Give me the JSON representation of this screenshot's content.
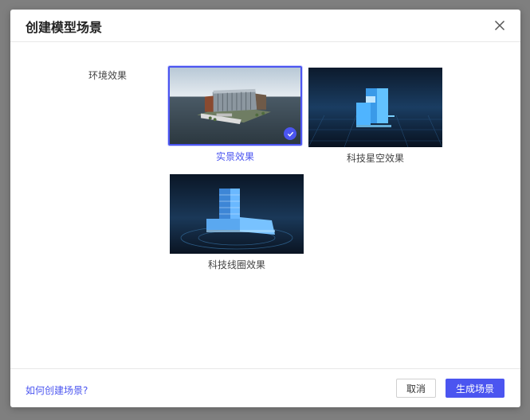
{
  "dialog": {
    "title": "创建模型场景",
    "field_label": "环境效果",
    "options": [
      {
        "label": "实景效果",
        "selected": true,
        "icon": "check-icon"
      },
      {
        "label": "科技星空效果",
        "selected": false
      },
      {
        "label": "科技线圈效果",
        "selected": false
      }
    ],
    "help_link": "如何创建场景?",
    "cancel_label": "取消",
    "confirm_label": "生成场景",
    "accent_color": "#4b55f0"
  }
}
